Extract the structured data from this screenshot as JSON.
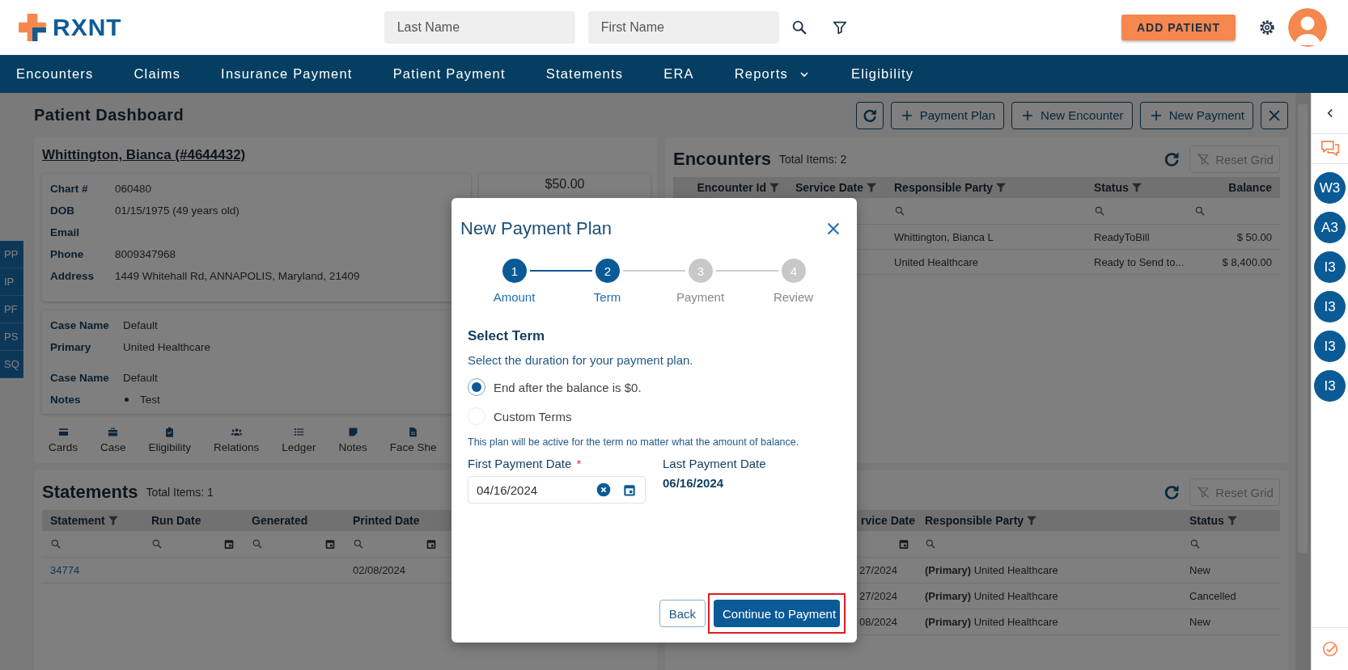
{
  "header": {
    "logo": "RXNT",
    "search_fields": [
      {
        "placeholder": "Last Name"
      },
      {
        "placeholder": "First Name"
      }
    ],
    "add_button": "ADD PATIENT"
  },
  "nav": [
    {
      "label": "Encounters",
      "has_menu": false
    },
    {
      "label": "Claims",
      "has_menu": false
    },
    {
      "label": "Insurance Payment",
      "has_menu": false
    },
    {
      "label": "Patient Payment",
      "has_menu": false
    },
    {
      "label": "Statements",
      "has_menu": false
    },
    {
      "label": "ERA",
      "has_menu": false
    },
    {
      "label": "Reports",
      "has_menu": true
    },
    {
      "label": "Eligibility",
      "has_menu": false
    }
  ],
  "side_tabs": [
    "PP",
    "IP",
    "PF",
    "PS",
    "SQ"
  ],
  "page": {
    "title": "Patient Dashboard",
    "actions": [
      "Payment Plan",
      "New Encounter",
      "New Payment"
    ]
  },
  "patient": {
    "name": "Whittington, Bianca (#4644432)",
    "details": [
      {
        "label": "Chart #",
        "value": "060480"
      },
      {
        "label": "DOB",
        "value": "01/15/1975 (49 years old)"
      },
      {
        "label": "Email"
      },
      {
        "label": "Phone",
        "value": "8009347968"
      },
      {
        "label": "Address",
        "value": "1449 Whitehall Rd, ANNAPOLIS, Maryland, 21409"
      }
    ],
    "balance": "$50.00",
    "case_groups": [
      [
        {
          "label": "Case Name",
          "value": "Default",
          "kind": "text"
        },
        {
          "label": "Primary",
          "value": "United Healthcare",
          "kind": "text"
        }
      ],
      [
        {
          "label": "Case Name",
          "value": "Default",
          "kind": "text"
        },
        {
          "label": "Notes",
          "value": "Test",
          "kind": "bullet"
        }
      ]
    ],
    "tools": [
      "Cards",
      "Case",
      "Eligibility",
      "Relations",
      "Ledger",
      "Notes",
      "Face She"
    ]
  },
  "encounters": {
    "title": "Encounters",
    "total": "Total Items: 2",
    "reset_button": {
      "label": "Reset Grid",
      "disabled": true
    },
    "columns": [
      {
        "label": "Encounter Id",
        "filter": true
      },
      {
        "label": "Service Date",
        "filter": true
      },
      {
        "label": "Responsible Party",
        "filter": true,
        "search": true
      },
      {
        "label": "Status",
        "filter": true,
        "search": true
      },
      {
        "label": "Balance",
        "filter": false,
        "search": true
      }
    ],
    "rows": [
      {
        "responsible_party": "Whittington, Bianca L",
        "status": "ReadyToBill",
        "balance": "$ 50.00"
      },
      {
        "responsible_party": "United Healthcare",
        "status": "Ready to Send to...",
        "balance": "$ 8,400.00"
      }
    ]
  },
  "statements": {
    "title": "Statements",
    "total": "Total Items: 1",
    "columns": [
      {
        "label": "Statement",
        "filter": true,
        "search": true,
        "calendar": false
      },
      {
        "label": "Run Date",
        "filter": false,
        "search": true,
        "calendar": true
      },
      {
        "label": "Generated",
        "filter": false,
        "search": true,
        "calendar": true
      },
      {
        "label": "Printed Date",
        "filter": false,
        "search": true,
        "calendar": true
      }
    ],
    "rows": [
      {
        "statement": "34774",
        "printed_date": "02/08/2024"
      }
    ]
  },
  "claims_grid": {
    "reset_button": {
      "label": "Reset Grid",
      "disabled": true
    },
    "columns": [
      {
        "label": "rvice Date",
        "filter": false,
        "search": false,
        "calendar": true
      },
      {
        "label": "Responsible Party",
        "filter": true,
        "search": true,
        "calendar": false
      },
      {
        "label": "Status",
        "filter": true,
        "search": true,
        "calendar": false
      }
    ],
    "rows": [
      {
        "date": "27/2024",
        "responsible_party": "**(Primary)** United Healthcare",
        "status": "New"
      },
      {
        "date": "27/2024",
        "responsible_party": "**(Primary)** United Healthcare",
        "status": "Cancelled"
      },
      {
        "date": "08/2024",
        "responsible_party": "**(Primary)** United Healthcare",
        "status": "New"
      }
    ]
  },
  "dialog": {
    "title": "New Payment Plan",
    "steps": [
      {
        "number": "1",
        "label": "Amount",
        "active": true
      },
      {
        "number": "2",
        "label": "Term",
        "active": true
      },
      {
        "number": "3",
        "label": "Payment",
        "active": false
      },
      {
        "number": "4",
        "label": "Review",
        "active": false
      }
    ],
    "section_title": "Select Term",
    "instruction": "Select the duration for your payment plan.",
    "options": [
      {
        "label": "End after the balance is $0.",
        "selected": true
      },
      {
        "label": "Custom Terms",
        "selected": false
      }
    ],
    "note": "This plan will be active for the term no matter what the amount of balance.",
    "first_payment": {
      "label": "First Payment Date",
      "required_mark": "*",
      "value": "04/16/2024"
    },
    "last_payment": {
      "label": "Last Payment Date",
      "value": "06/16/2024"
    },
    "buttons": [
      {
        "label": "Back",
        "kind": "secondary",
        "highlighted": false
      },
      {
        "label": "Continue to Payment",
        "kind": "primary",
        "highlighted": true
      }
    ]
  },
  "right_rail": {
    "badges": [
      "W3",
      "A3",
      "I3",
      "I3",
      "I3",
      "I3"
    ]
  }
}
